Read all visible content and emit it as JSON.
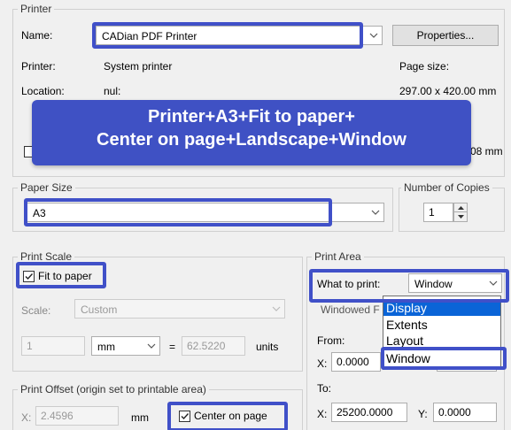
{
  "printer": {
    "legend": "Printer",
    "name_label": "Name:",
    "name_value": "CADian PDF Printer",
    "properties_button": "Properties...",
    "printer_label": "Printer:",
    "printer_value": "System printer",
    "location_label": "Location:",
    "location_value": "nul:",
    "page_size_label": "Page size:",
    "page_size_value": "297.00 x 420.00 mm",
    "partial_value": "08 mm"
  },
  "banner": {
    "line1": "Printer+A3+Fit to paper+",
    "line2": "Center on page+Landscape+Window"
  },
  "paper_size": {
    "legend": "Paper Size",
    "value": "A3"
  },
  "copies": {
    "legend": "Number of Copies",
    "value": "1"
  },
  "print_scale": {
    "legend": "Print Scale",
    "fit_to_paper_label": "Fit to paper",
    "fit_to_paper_checked": true,
    "scale_label": "Scale:",
    "scale_value": "Custom",
    "num1": "1",
    "unit": "mm",
    "equals": "=",
    "num2": "62.5220",
    "units_label": "units"
  },
  "print_offset": {
    "legend": "Print Offset (origin set to printable area)",
    "x_label": "X:",
    "x_value": "2.4596",
    "x_unit": "mm",
    "center_label": "Center on page",
    "center_checked": true
  },
  "print_area": {
    "legend": "Print Area",
    "what_label": "What to print:",
    "what_value": "Window",
    "windowed_label": "Windowed F",
    "from_label": "From:",
    "from_x_label": "X:",
    "from_x_value": "0.0000",
    "to_label": "To:",
    "to_x_label": "X:",
    "to_x_value": "25200.0000",
    "to_y_label": "Y:",
    "to_y_value": "0.0000",
    "options": [
      "Display",
      "Extents",
      "Layout",
      "Window"
    ],
    "highlighted_option": "Display"
  },
  "colors": {
    "accent": "#3f51c4",
    "highlight_border": "#4050c8",
    "selection": "#0a64d7"
  }
}
